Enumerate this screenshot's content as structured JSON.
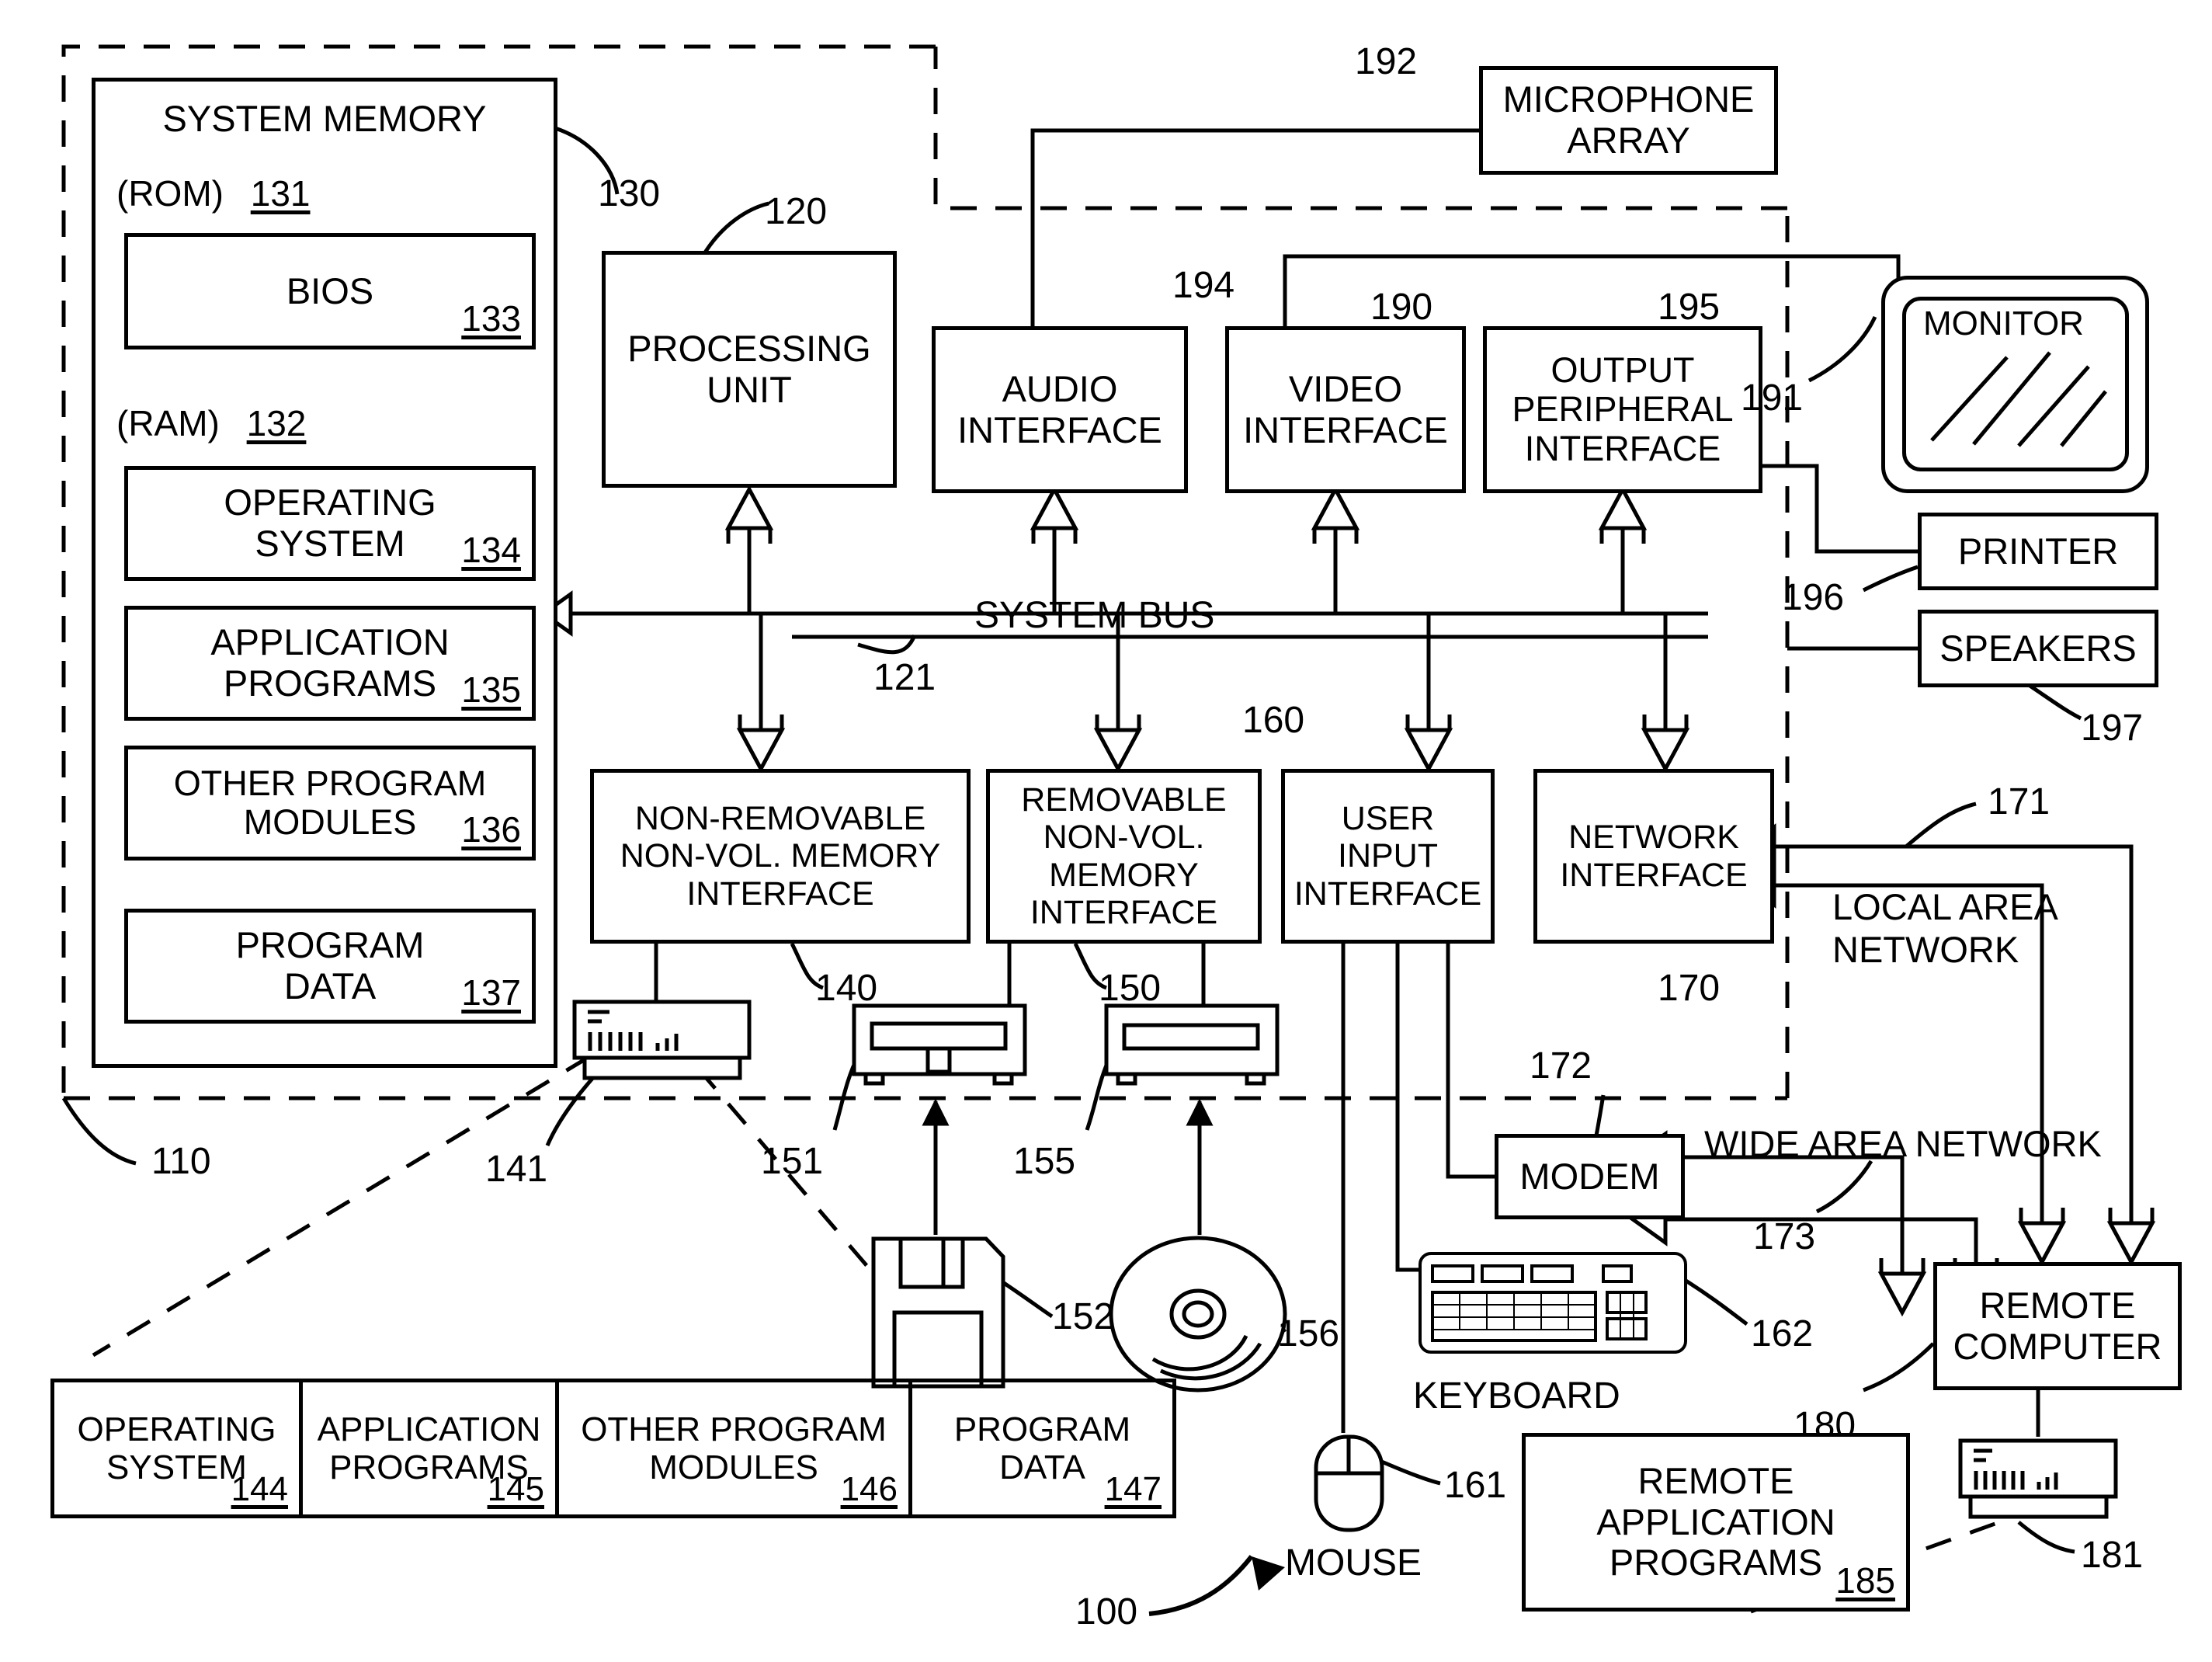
{
  "figure": {
    "figure_ref": "100",
    "computer_ref": "110"
  },
  "system_memory": {
    "title": "SYSTEM MEMORY",
    "ref": "130",
    "rom": {
      "label": "(ROM)",
      "ref": "131"
    },
    "bios": {
      "label": "BIOS",
      "ref": "133"
    },
    "ram": {
      "label": "(RAM)",
      "ref": "132"
    },
    "items": [
      {
        "line1": "OPERATING",
        "line2": "SYSTEM",
        "ref": "134"
      },
      {
        "line1": "APPLICATION",
        "line2": "PROGRAMS",
        "ref": "135"
      },
      {
        "line1": "OTHER PROGRAM",
        "line2": "MODULES",
        "ref": "136"
      },
      {
        "line1": "PROGRAM",
        "line2": "DATA",
        "ref": "137"
      }
    ]
  },
  "processing_unit": {
    "line1": "PROCESSING",
    "line2": "UNIT",
    "ref": "120"
  },
  "system_bus": {
    "label": "SYSTEM BUS",
    "ref": "121"
  },
  "top_interfaces": [
    {
      "line1": "AUDIO",
      "line2": "INTERFACE",
      "ref": "194"
    },
    {
      "line1": "VIDEO",
      "line2": "INTERFACE",
      "ref": "190"
    },
    {
      "line1": "OUTPUT",
      "line2": "PERIPHERAL",
      "line3": "INTERFACE",
      "ref": "195"
    }
  ],
  "bottom_interfaces": [
    {
      "line1": "NON-REMOVABLE",
      "line2": "NON-VOL. MEMORY",
      "line3": "INTERFACE",
      "ref": "140"
    },
    {
      "line1": "REMOVABLE",
      "line2": "NON-VOL.",
      "line3": "MEMORY",
      "line4": "INTERFACE",
      "ref": "150"
    },
    {
      "line1": "USER",
      "line2": "INPUT",
      "line3": "INTERFACE",
      "ref": "160"
    },
    {
      "line1": "NETWORK",
      "line2": "INTERFACE",
      "ref": "170"
    }
  ],
  "peripherals": {
    "microphone_array": {
      "line1": "MICROPHONE",
      "line2": "ARRAY",
      "ref": "192"
    },
    "monitor": {
      "label": "MONITOR",
      "ref": "191"
    },
    "printer": {
      "label": "PRINTER",
      "ref": "196"
    },
    "speakers": {
      "label": "SPEAKERS",
      "ref": "197"
    },
    "keyboard": {
      "label": "KEYBOARD",
      "ref": "162"
    },
    "mouse": {
      "label": "MOUSE",
      "ref": "161"
    }
  },
  "storage": {
    "hard_disk_ref": "141",
    "floppy_drive_ref": "151",
    "floppy_disk_ref": "152",
    "cd_drive_ref": "155",
    "cd_disc_ref": "156"
  },
  "storage_table": {
    "cells": [
      {
        "line1": "OPERATING",
        "line2": "SYSTEM",
        "ref": "144"
      },
      {
        "line1": "APPLICATION",
        "line2": "PROGRAMS",
        "ref": "145"
      },
      {
        "line1": "OTHER PROGRAM",
        "line2": "MODULES",
        "ref": "146"
      },
      {
        "line1": "PROGRAM",
        "line2": "DATA",
        "ref": "147"
      }
    ]
  },
  "network": {
    "local_area_network": {
      "line1": "LOCAL AREA",
      "line2": "NETWORK",
      "ref": "171"
    },
    "wide_area_network": {
      "label": "WIDE AREA NETWORK",
      "ref": "173"
    },
    "modem": {
      "label": "MODEM",
      "ref": "172"
    },
    "remote_computer": {
      "line1": "REMOTE",
      "line2": "COMPUTER",
      "ref": "180"
    },
    "remote_disk_ref": "181",
    "remote_application_programs": {
      "line1": "REMOTE",
      "line2": "APPLICATION",
      "line3": "PROGRAMS",
      "ref": "185"
    }
  }
}
